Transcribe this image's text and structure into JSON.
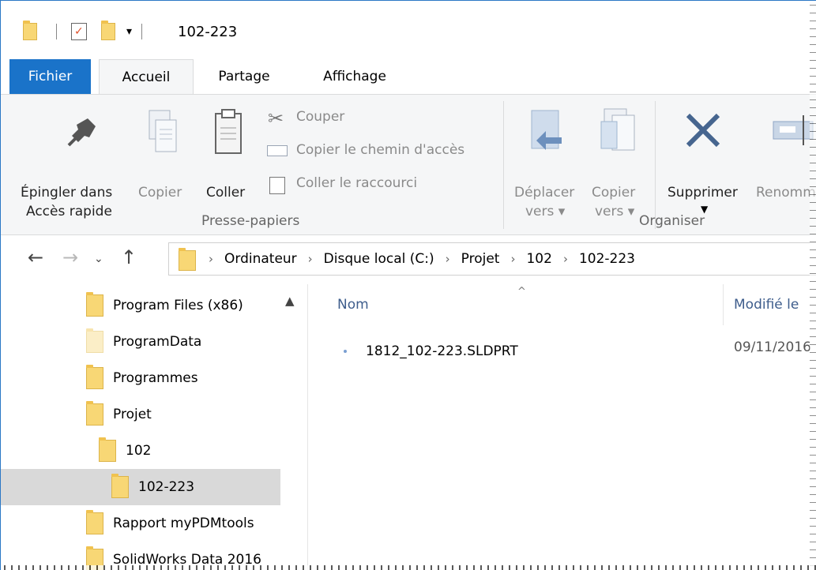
{
  "window": {
    "title": "102-223"
  },
  "tabs": {
    "file": "Fichier",
    "home": "Accueil",
    "share": "Partage",
    "view": "Affichage"
  },
  "ribbon": {
    "pin_line1": "Épingler dans",
    "pin_line2": "Accès rapide",
    "copy": "Copier",
    "paste": "Coller",
    "cut": "Couper",
    "copy_path": "Copier le chemin d'accès",
    "paste_shortcut": "Coller le raccourci",
    "group_clipboard": "Presse-papiers",
    "move_line1": "Déplacer",
    "move_line2": "vers",
    "copyto_line1": "Copier",
    "copyto_line2": "vers",
    "delete": "Supprimer",
    "rename": "Renommer",
    "group_organise": "Organiser"
  },
  "breadcrumb": [
    "Ordinateur",
    "Disque local (C:)",
    "Projet",
    "102",
    "102-223"
  ],
  "nav_items": [
    {
      "label": "Program Files (x86)"
    },
    {
      "label": "ProgramData"
    },
    {
      "label": "Programmes"
    },
    {
      "label": "Projet"
    },
    {
      "label": "102"
    },
    {
      "label": "102-223"
    },
    {
      "label": "Rapport myPDMtools"
    },
    {
      "label": "SolidWorks Data 2016"
    }
  ],
  "columns": {
    "name": "Nom",
    "modified": "Modifié le"
  },
  "files": [
    {
      "name": "1812_102-223.SLDPRT",
      "modified": "09/11/2016"
    }
  ]
}
